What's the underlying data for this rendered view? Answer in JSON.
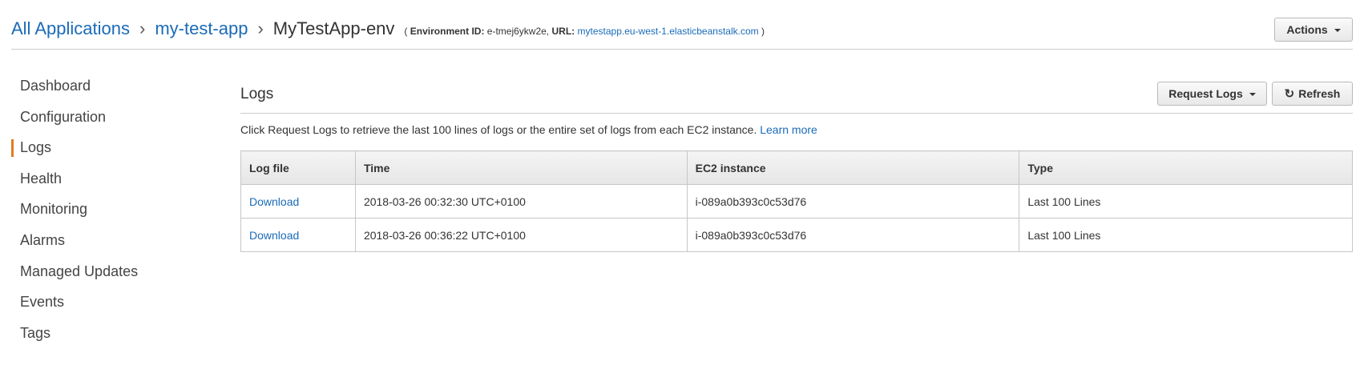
{
  "header": {
    "breadcrumb": {
      "all_applications": "All Applications",
      "separator": "›",
      "application": "my-test-app",
      "environment": "MyTestApp-env"
    },
    "env_meta": {
      "open_paren": "(",
      "env_id_label": "Environment ID:",
      "env_id_value": "e-tmej6ykw2e,",
      "url_label": "URL:",
      "url_value": "mytestapp.eu-west-1.elasticbeanstalk.com",
      "close_paren": ")"
    },
    "actions_label": "Actions"
  },
  "sidebar": {
    "items": [
      {
        "label": "Dashboard",
        "active": false
      },
      {
        "label": "Configuration",
        "active": false
      },
      {
        "label": "Logs",
        "active": true
      },
      {
        "label": "Health",
        "active": false
      },
      {
        "label": "Monitoring",
        "active": false
      },
      {
        "label": "Alarms",
        "active": false
      },
      {
        "label": "Managed Updates",
        "active": false
      },
      {
        "label": "Events",
        "active": false
      },
      {
        "label": "Tags",
        "active": false
      }
    ],
    "active_color": "#e07b25"
  },
  "main": {
    "title": "Logs",
    "request_logs_label": "Request Logs",
    "refresh_label": "Refresh",
    "description": "Click Request Logs to retrieve the last 100 lines of logs or the entire set of logs from each EC2 instance.",
    "learn_more": "Learn more",
    "table": {
      "columns": [
        "Log file",
        "Time",
        "EC2 instance",
        "Type"
      ],
      "rows": [
        {
          "log_file": "Download",
          "time": "2018-03-26 00:32:30 UTC+0100",
          "instance": "i-089a0b393c0c53d76",
          "type": "Last 100 Lines"
        },
        {
          "log_file": "Download",
          "time": "2018-03-26 00:36:22 UTC+0100",
          "instance": "i-089a0b393c0c53d76",
          "type": "Last 100 Lines"
        }
      ]
    }
  },
  "colors": {
    "link": "#1a6bb8",
    "text": "#333333",
    "accent": "#e07b25"
  },
  "icons": {
    "dropdown": "caret-down-icon",
    "refresh": "refresh-icon"
  }
}
